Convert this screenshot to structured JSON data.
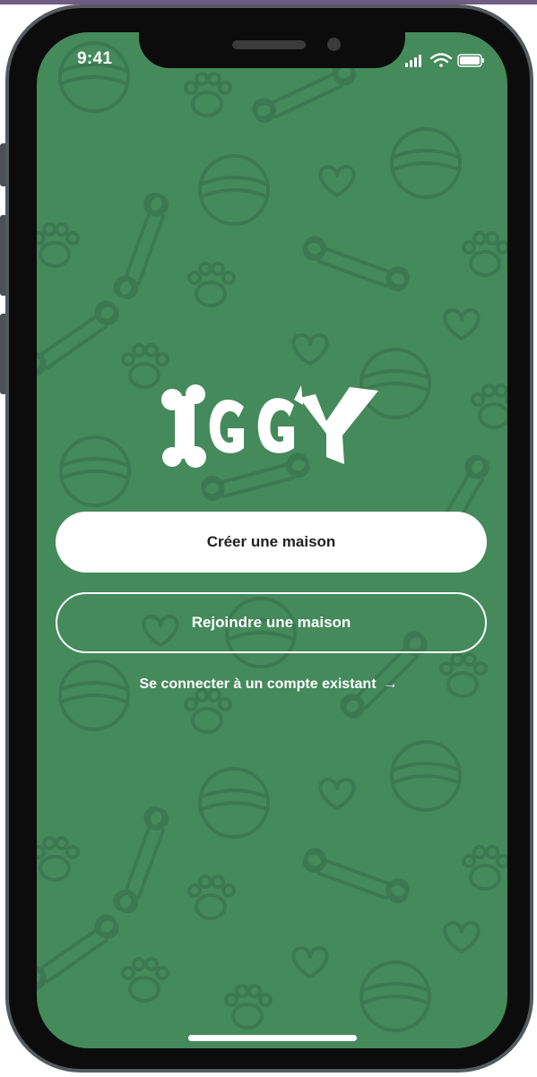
{
  "status_bar": {
    "time": "9:41",
    "icons": [
      "signal-icon",
      "wifi-icon",
      "battery-icon"
    ]
  },
  "brand": {
    "logo_text": "IGGY",
    "background_color": "#458a5b",
    "pattern_icons": [
      "bone-icon",
      "paw-icon",
      "ball-icon",
      "heart-icon"
    ]
  },
  "actions": {
    "create_label": "Créer une maison",
    "join_label": "Rejoindre une maison",
    "login_label": "Se connecter à un compte existant",
    "login_arrow": "→"
  }
}
